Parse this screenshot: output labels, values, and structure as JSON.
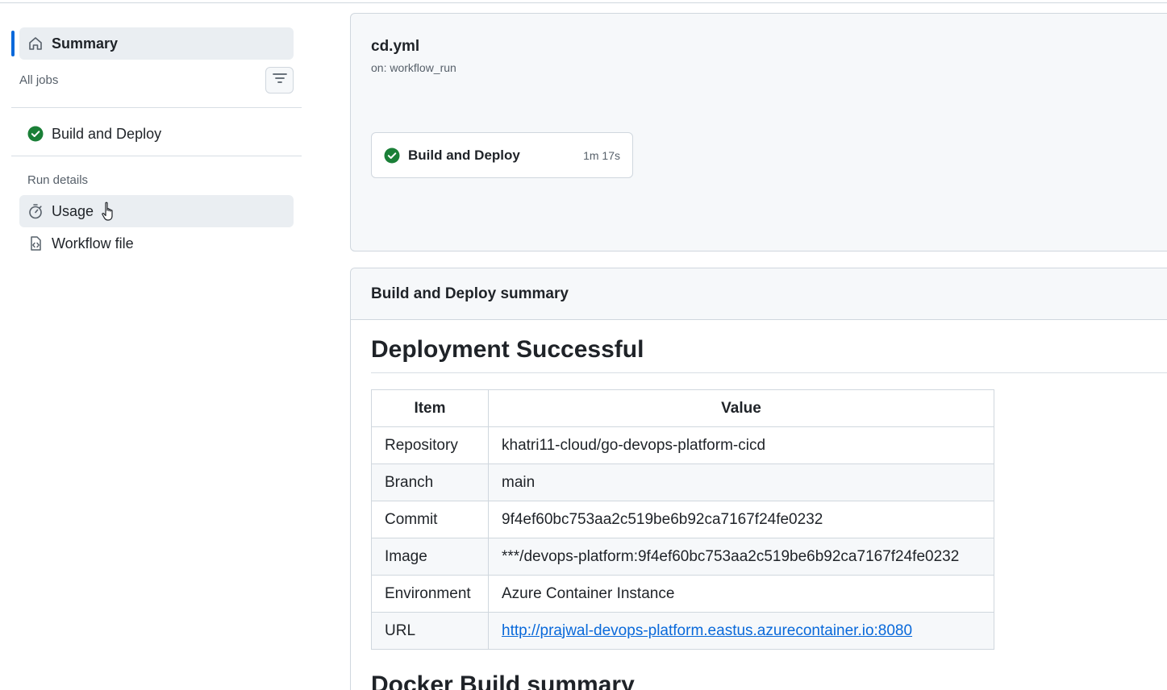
{
  "sidebar": {
    "summary_label": "Summary",
    "all_jobs_label": "All jobs",
    "jobs": [
      {
        "label": "Build and Deploy",
        "status": "success"
      }
    ],
    "run_details_label": "Run details",
    "usage_label": "Usage",
    "workflow_file_label": "Workflow file"
  },
  "workflow": {
    "file": "cd.yml",
    "trigger": "on: workflow_run",
    "job": {
      "name": "Build and Deploy",
      "duration": "1m 17s",
      "status": "success"
    }
  },
  "summary": {
    "header": "Build and Deploy summary",
    "heading": "Deployment Successful",
    "table": {
      "headers": [
        "Item",
        "Value"
      ],
      "rows": [
        {
          "item": "Repository",
          "value": "khatri11-cloud/go-devops-platform-cicd"
        },
        {
          "item": "Branch",
          "value": "main"
        },
        {
          "item": "Commit",
          "value": "9f4ef60bc753aa2c519be6b92ca7167f24fe0232"
        },
        {
          "item": "Image",
          "value": "***/devops-platform:9f4ef60bc753aa2c519be6b92ca7167f24fe0232"
        },
        {
          "item": "Environment",
          "value": "Azure Container Instance"
        },
        {
          "item": "URL",
          "value": "http://prajwal-devops-platform.eastus.azurecontainer.io:8080"
        }
      ]
    },
    "next_heading": "Docker Build summary"
  },
  "colors": {
    "accent": "#0969da",
    "success": "#1a7f37",
    "border": "#d0d7de"
  }
}
